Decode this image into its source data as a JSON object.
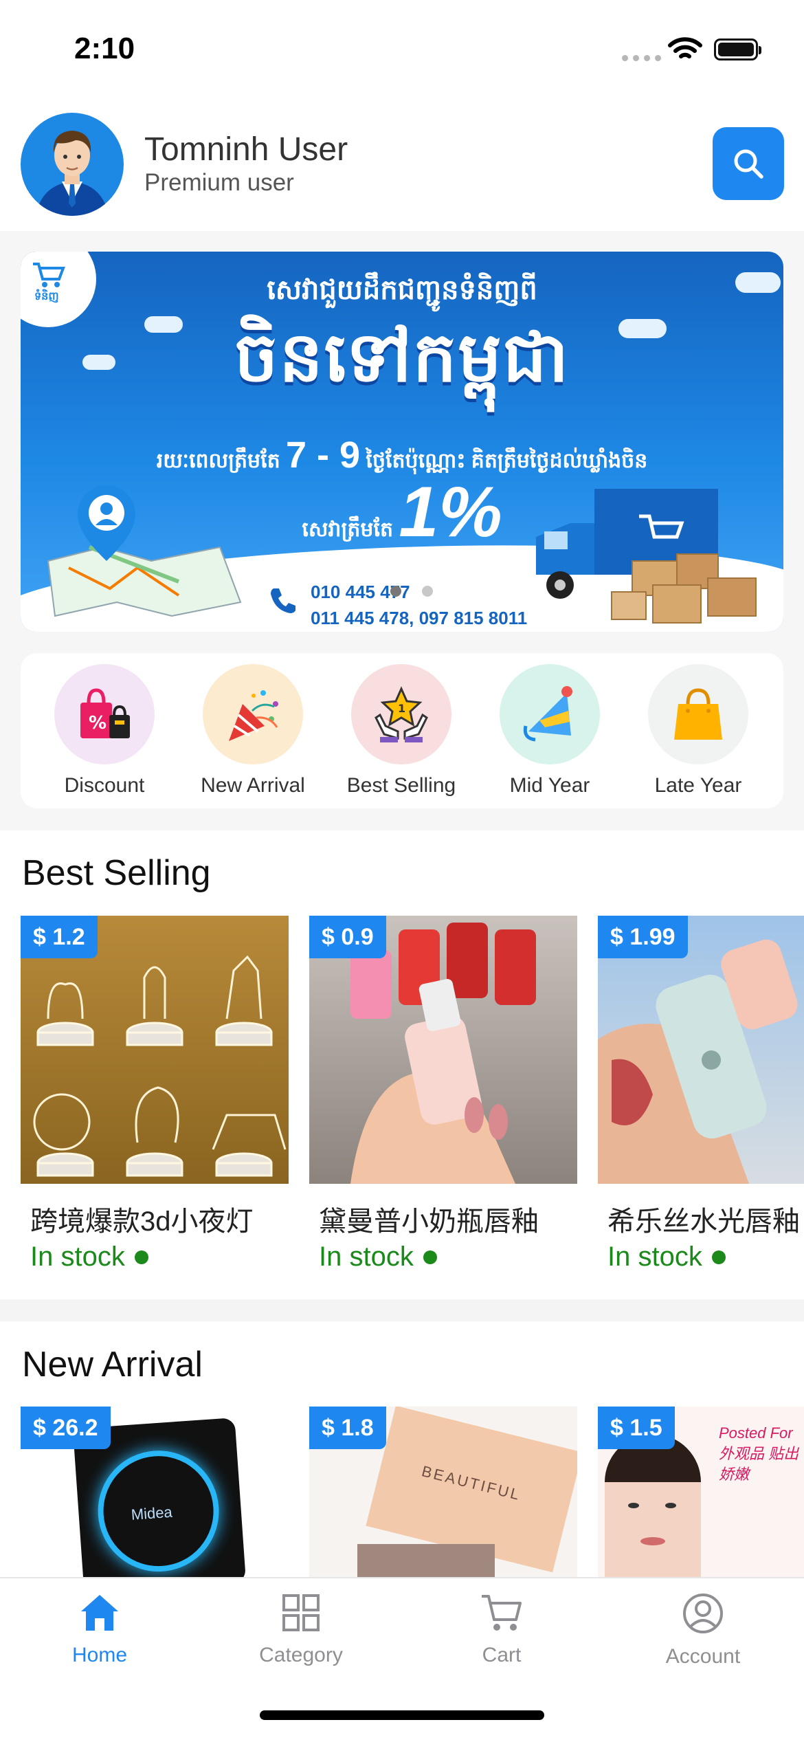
{
  "status_bar": {
    "time": "2:10"
  },
  "header": {
    "user_name": "Tomninh User",
    "user_role": "Premium user",
    "search_icon": "search-icon"
  },
  "banner": {
    "line1": "សេវាជួយដឹកជញ្ជូនទំនិញពី",
    "line2": "ចិនទៅកម្ពុជា",
    "line3_pre": "រយៈពេលត្រឹមតែ",
    "line3_days": "7 - 9",
    "line3_post": "ថ្ងៃតែប៉ុណ្ណោះ គិតត្រឹមថ្ងៃដល់ឃ្លាំងចិន",
    "line4_pre": "សេវាត្រឹមតែ",
    "line4_rate": "1%",
    "phone1": "010 445 477",
    "phone2": "011 445 478, 097 815 8011",
    "brand": "ទំនិញ",
    "page_index": 1,
    "page_count": 2
  },
  "categories": [
    {
      "label": "Discount",
      "icon": "shopping-bags-icon",
      "bg": "#f3e5f5"
    },
    {
      "label": "New Arrival",
      "icon": "party-popper-icon",
      "bg": "#fdebd0"
    },
    {
      "label": "Best Selling",
      "icon": "trophy-hands-icon",
      "bg": "#f8dede"
    },
    {
      "label": "Mid Year",
      "icon": "party-hat-icon",
      "bg": "#d7f3ec"
    },
    {
      "label": "Late Year",
      "icon": "shopping-bag-icon",
      "bg": "#f1f2f2"
    }
  ],
  "best_selling": {
    "title": "Best Selling",
    "items": [
      {
        "price": "$ 1.2",
        "name": "跨境爆款3d小夜灯",
        "stock": "In stock"
      },
      {
        "price": "$ 0.9",
        "name": "黛曼普小奶瓶唇釉",
        "stock": "In stock"
      },
      {
        "price": "$ 1.99",
        "name": "希乐丝水光唇釉",
        "stock": "In stock"
      }
    ]
  },
  "new_arrival": {
    "title": "New Arrival",
    "items": [
      {
        "price": "$ 26.2",
        "image_text": "Midea"
      },
      {
        "price": "$ 1.8",
        "image_text": "BEAUTIFUL"
      },
      {
        "price": "$ 1.5",
        "image_text": "Posted For 外观品 贴出娇嫩"
      }
    ]
  },
  "bottom_nav": [
    {
      "label": "Home",
      "icon": "home-icon",
      "active": true
    },
    {
      "label": "Category",
      "icon": "grid-icon",
      "active": false
    },
    {
      "label": "Cart",
      "icon": "cart-icon",
      "active": false
    },
    {
      "label": "Account",
      "icon": "account-icon",
      "active": false
    }
  ],
  "colors": {
    "accent": "#1e88f0",
    "in_stock": "#1b8a1b"
  }
}
